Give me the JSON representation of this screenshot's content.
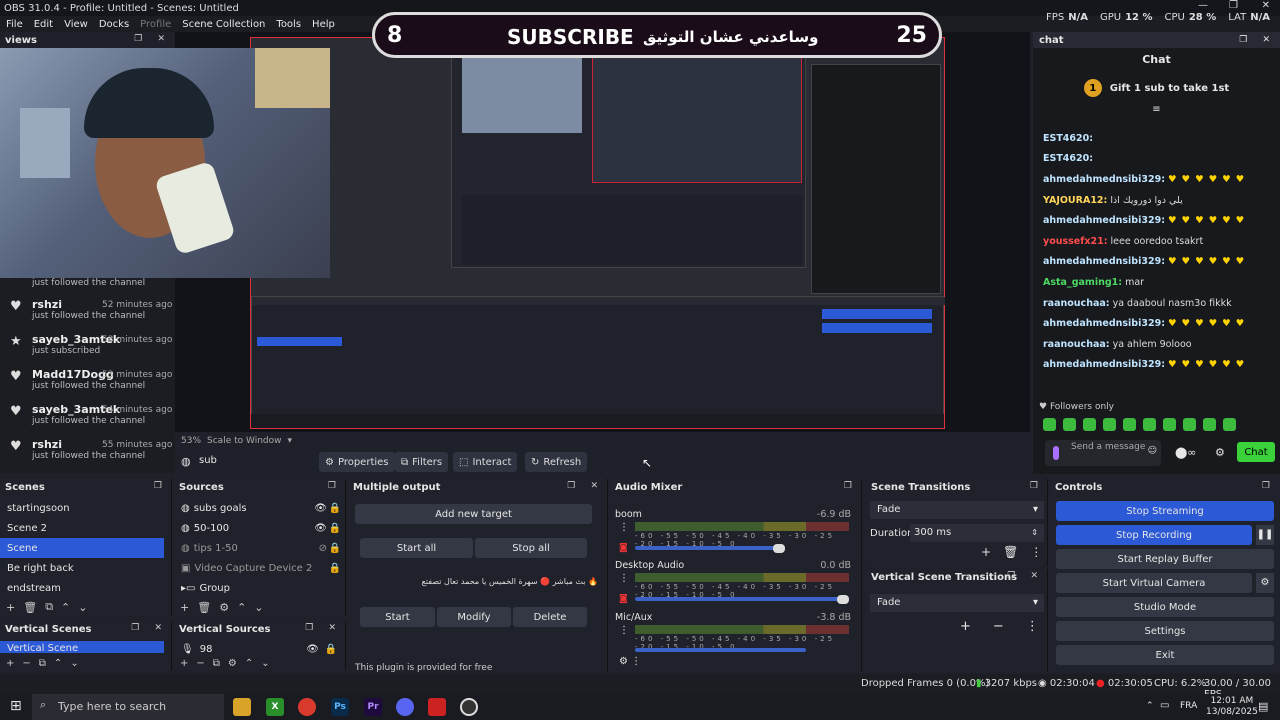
{
  "window": {
    "title": "OBS 31.0.4 - Profile: Untitled - Scenes: Untitled"
  },
  "menu": [
    "File",
    "Edit",
    "View",
    "Docks",
    "Profile",
    "Scene Collection",
    "Tools",
    "Help"
  ],
  "stats": {
    "fps_label": "FPS",
    "fps": "N/A",
    "gpu_label": "GPU",
    "gpu": "12 %",
    "cpu_label": "CPU",
    "cpu": "28 %",
    "lat_label": "LAT",
    "lat": "N/A"
  },
  "views_dock": {
    "title": "views"
  },
  "overlay": {
    "left_count": "8",
    "subscribe": "SUBSCRIBE",
    "arabic": "وساعدني عشان التوثيق",
    "right_count": "25"
  },
  "follows": [
    {
      "name": "",
      "time": "",
      "action": "just followed the channel",
      "icon": "heart-icon"
    },
    {
      "name": "rshzi",
      "time": "52 minutes ago",
      "action": "just followed the channel",
      "icon": "heart-icon"
    },
    {
      "name": "sayeb_3amtek",
      "time": "53 minutes ago",
      "action": "just subscribed",
      "icon": "star-icon"
    },
    {
      "name": "Madd17Dogg",
      "time": "53 minutes ago",
      "action": "just followed the channel",
      "icon": "heart-icon"
    },
    {
      "name": "sayeb_3amtek",
      "time": "54 minutes ago",
      "action": "just followed the channel",
      "icon": "heart-icon"
    },
    {
      "name": "rshzi",
      "time": "55 minutes ago",
      "action": "just followed the channel",
      "icon": "heart-icon"
    }
  ],
  "preview_footer": {
    "zoom": "53%",
    "scale": "Scale to Window"
  },
  "source_toolbar": {
    "source": "sub",
    "properties": "Properties",
    "filters": "Filters",
    "interact": "Interact",
    "refresh": "Refresh"
  },
  "chat": {
    "dock_title": "chat",
    "header": "Chat",
    "gift_count": "1",
    "gift_text": "Gift 1 sub to take 1st",
    "messages": [
      {
        "user": "EST4620:",
        "text": "",
        "color": "#bfe4ff"
      },
      {
        "user": "EST4620:",
        "text": "",
        "color": "#bfe4ff"
      },
      {
        "user": "ahmedahmednsibi329:",
        "text": "♥ ♥ ♥ ♥ ♥ ♥",
        "color": "#bfe4ff",
        "hearts": true
      },
      {
        "user": "YAJOURA12:",
        "text": "يلي دوا دورويك اذا",
        "color": "#ffd65a"
      },
      {
        "user": "ahmedahmednsibi329:",
        "text": "♥ ♥ ♥ ♥ ♥ ♥",
        "color": "#bfe4ff",
        "hearts": true
      },
      {
        "user": "youssefx21:",
        "text": "leee ooredoo tsakrt",
        "color": "#ff4d4d"
      },
      {
        "user": "ahmedahmednsibi329:",
        "text": "♥ ♥ ♥ ♥ ♥ ♥",
        "color": "#bfe4ff",
        "hearts": true
      },
      {
        "user": "Asta_gaming1:",
        "text": "mar",
        "color": "#4cd964"
      },
      {
        "user": "raanouchaa:",
        "text": "ya daaboul nasm3o fikkk",
        "color": "#bfe4ff"
      },
      {
        "user": "ahmedahmednsibi329:",
        "text": "♥ ♥ ♥ ♥ ♥ ♥",
        "color": "#bfe4ff",
        "hearts": true
      },
      {
        "user": "raanouchaa:",
        "text": "ya ahlem 9olooo",
        "color": "#bfe4ff"
      },
      {
        "user": "ahmedahmednsibi329:",
        "text": "♥ ♥ ♥ ♥ ♥ ♥",
        "color": "#bfe4ff",
        "hearts": true
      }
    ],
    "followers_only": "Followers only",
    "input_placeholder": "Send a message",
    "send_label": "Chat"
  },
  "scenes": {
    "title": "Scenes",
    "items": [
      "startingsoon",
      "Scene 2",
      "Scene",
      "Be right back",
      "endstream"
    ],
    "selected": 2
  },
  "sources": {
    "title": "Sources",
    "items": [
      "subs goals",
      "50-100",
      "tips 1-50",
      "Video Capture Device 2",
      "Group"
    ]
  },
  "multiple_output": {
    "title": "Multiple output",
    "add_target": "Add new target",
    "start_all": "Start all",
    "stop_all": "Stop all",
    "target_name": "بث مباشر 🔴 سهرة الخميس يا محمد تعال تصفتع 🔥",
    "start": "Start",
    "modify": "Modify",
    "delete": "Delete",
    "footer": "This plugin is provided for free"
  },
  "audio_mixer": {
    "title": "Audio Mixer",
    "channels": [
      {
        "name": "boom",
        "db": "-6.9 dB",
        "level": 0.7
      },
      {
        "name": "Desktop Audio",
        "db": "0.0 dB",
        "level": 1.0
      },
      {
        "name": "Mic/Aux",
        "db": "-3.8 dB",
        "level": 0.8
      }
    ],
    "scale": "-60 -55 -50 -45 -40 -35 -30 -25 -20 -15 -10 -5 0"
  },
  "scene_transitions": {
    "title": "Scene Transitions",
    "transition": "Fade",
    "duration_label": "Duration",
    "duration": "300 ms"
  },
  "vertical_scene_transitions": {
    "title": "Vertical Scene Transitions",
    "transition": "Fade"
  },
  "controls": {
    "title": "Controls",
    "stop_streaming": "Stop Streaming",
    "stop_recording": "Stop Recording",
    "replay_buffer": "Start Replay Buffer",
    "virtual_camera": "Start Virtual Camera",
    "studio_mode": "Studio Mode",
    "settings": "Settings",
    "exit": "Exit"
  },
  "vertical_scenes": {
    "title": "Vertical Scenes",
    "items": [
      "Vertical Scene"
    ]
  },
  "vertical_sources": {
    "title": "Vertical Sources",
    "items": [
      "98"
    ]
  },
  "status": {
    "dropped": "Dropped Frames 0 (0.0%)",
    "bitrate": "3207 kbps",
    "stream_time": "02:30:04",
    "rec_time": "02:30:05",
    "cpu": "CPU: 6.2%",
    "fps": "30.00 / 30.00 FPS"
  },
  "taskbar": {
    "search_placeholder": "Type here to search",
    "lang": "FRA",
    "time": "12:01 AM",
    "date": "13/08/2025"
  }
}
